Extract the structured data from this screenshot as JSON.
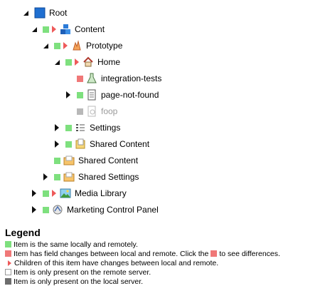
{
  "tree": {
    "root": {
      "label": "Root"
    },
    "content": {
      "label": "Content"
    },
    "prototype": {
      "label": "Prototype"
    },
    "home": {
      "label": "Home"
    },
    "integration_tests": {
      "label": "integration-tests"
    },
    "page_not_found": {
      "label": "page-not-found"
    },
    "foop": {
      "label": "foop"
    },
    "settings": {
      "label": "Settings"
    },
    "shared_content_child": {
      "label": "Shared Content"
    },
    "shared_content": {
      "label": "Shared Content"
    },
    "shared_settings": {
      "label": "Shared Settings"
    },
    "media_library": {
      "label": "Media Library"
    },
    "marketing_control_panel": {
      "label": "Marketing Control Panel"
    }
  },
  "legend": {
    "title": "Legend",
    "same": "Item is the same locally and remotely.",
    "changes_prefix": "Item has field changes between local and remote. Click the",
    "changes_suffix": "to see differences.",
    "children": "Children of this item have changes between local and remote.",
    "remote_only": "Item is only present on the remote server.",
    "local_only": "Item is only present on the local server."
  },
  "colors": {
    "same": "#7ee07e",
    "changed": "#f07878",
    "remote_only": "#ffffff",
    "local_only": "#6d6d6d",
    "child_changes": "#ee5a5a"
  }
}
